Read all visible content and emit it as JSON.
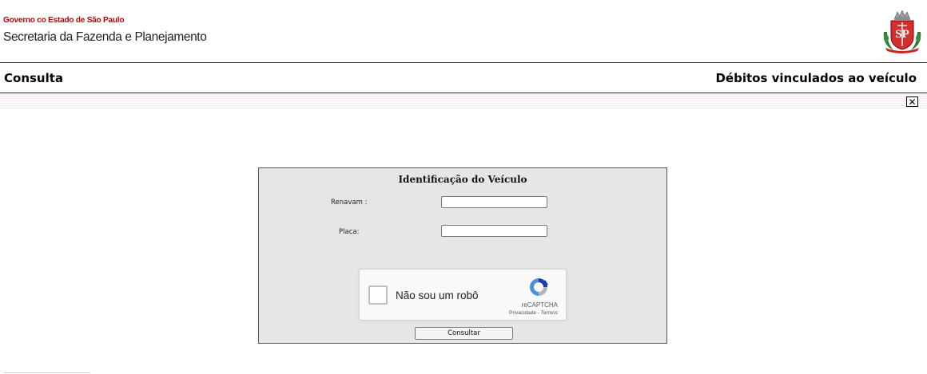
{
  "header": {
    "gov_line": "Governo co Estado de São Paulo",
    "secretaria": "Secretaria da Fazenda e Planejamento",
    "logo_text": "SP",
    "logo_icon": "sao-paulo-coat-of-arms"
  },
  "titlebar": {
    "page_title": "Consulta",
    "section_title": "Débitos vinculados ao veículo",
    "close_icon": "close-x-icon",
    "close_symbol": "✕"
  },
  "form": {
    "title": "Identificação do Veículo",
    "renavam_label": "Renavam :",
    "renavam_value": "",
    "placa_label": "Placa:",
    "placa_value": "",
    "submit_label": "Consultar"
  },
  "recaptcha": {
    "checkbox_label": "Não sou um robô",
    "brand": "reCAPTCHA",
    "privacy": "Privacidade",
    "separator": " - ",
    "terms": "Termos"
  },
  "colors": {
    "gov_red": "#c00000",
    "panel_bg": "#e6e6e6",
    "recaptcha_blue": "#1c3aa9",
    "recaptcha_light_blue": "#4a90e2",
    "recaptcha_gray": "#b3b3b3"
  }
}
